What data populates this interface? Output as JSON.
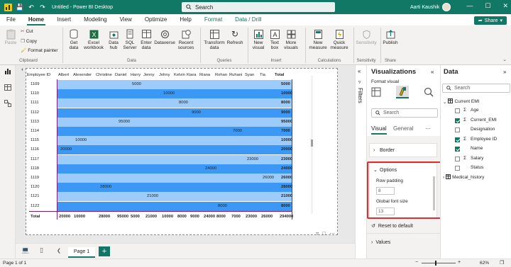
{
  "titlebar": {
    "doc_title": "Untitled - Power BI Desktop",
    "search_placeholder": "Search",
    "user_name": "Aarti Kaushik",
    "minimize": "—",
    "maximize": "☐",
    "close": "✕"
  },
  "menu": {
    "items": [
      "File",
      "Home",
      "Insert",
      "Modeling",
      "View",
      "Optimize",
      "Help",
      "Format",
      "Data / Drill"
    ],
    "share_label": "Share"
  },
  "ribbon": {
    "clipboard": {
      "paste": "Paste",
      "cut": "Cut",
      "copy": "Copy",
      "format_painter": "Format painter",
      "label": "Clipboard"
    },
    "data": {
      "get_data": "Get data",
      "excel_workbook": "Excel workbook",
      "data_hub": "Data hub",
      "sql_server": "SQL Server",
      "enter_data": "Enter data",
      "dataverse": "Dataverse",
      "recent_sources": "Recent sources",
      "label": "Data"
    },
    "queries": {
      "transform_data": "Transform data",
      "refresh": "Refresh",
      "label": "Queries"
    },
    "insert": {
      "new_visual": "New visual",
      "text_box": "Text box",
      "more_visuals": "More visuals",
      "label": "Insert"
    },
    "calculations": {
      "new_measure": "New measure",
      "quick_measure": "Quick measure",
      "label": "Calculations"
    },
    "sensitivity": {
      "sensitivity": "Sensitivity",
      "label": "Sensitivity"
    },
    "share": {
      "publish": "Publish",
      "label": "Share"
    }
  },
  "matrix": {
    "headers": [
      "Employee ID",
      "Albert",
      "Alexender",
      "Christine",
      "Daniel",
      "Harry",
      "Jenny",
      "Johny",
      "Kelvin",
      "Kiara",
      "Riana",
      "Rohan",
      "Ruhani",
      "Syan",
      "Tia",
      "Total"
    ],
    "rows": [
      {
        "id": "1109",
        "col": 5,
        "value": "5000",
        "total": "5000"
      },
      {
        "id": "1110",
        "col": 7,
        "value": "10000",
        "total": "10000"
      },
      {
        "id": "1111",
        "col": 8,
        "value": "8000",
        "total": "8000"
      },
      {
        "id": "1112",
        "col": 9,
        "value": "9000",
        "total": "9000"
      },
      {
        "id": "1113",
        "col": 4,
        "value": "95000",
        "total": "95000"
      },
      {
        "id": "1114",
        "col": 12,
        "value": "7000",
        "total": "7000"
      },
      {
        "id": "1115",
        "col": 2,
        "value": "10000",
        "total": "10000"
      },
      {
        "id": "1116",
        "col": 1,
        "value": "20000",
        "total": "20000"
      },
      {
        "id": "1117",
        "col": 13,
        "value": "23000",
        "total": "23000"
      },
      {
        "id": "1118",
        "col": 10,
        "value": "24000",
        "total": "24000"
      },
      {
        "id": "1119",
        "col": 14,
        "value": "26000",
        "total": "26000"
      },
      {
        "id": "1120",
        "col": 3,
        "value": "28000",
        "total": "28000"
      },
      {
        "id": "1121",
        "col": 6,
        "value": "21000",
        "total": "21000"
      },
      {
        "id": "1122",
        "col": 11,
        "value": "8000",
        "total": "8000"
      }
    ],
    "total_row": {
      "label": "Total",
      "values": [
        "20000",
        "10000",
        "28000",
        "95000",
        "5000",
        "21000",
        "10000",
        "8000",
        "9000",
        "24000",
        "8000",
        "7000",
        "23000",
        "26000",
        "294000"
      ]
    }
  },
  "pages": {
    "tab_label": "Page 1",
    "add_label": "+"
  },
  "status": {
    "page_info": "Page 1 of 1",
    "zoom": "62%"
  },
  "filters": {
    "label": "Filters"
  },
  "visualizations": {
    "title": "Visualizations",
    "format_visual": "Format visual",
    "search_placeholder": "Search",
    "tabs": [
      "Visual",
      "General"
    ],
    "more": "···",
    "border": "Border",
    "options": "Options",
    "row_padding_label": "Row padding",
    "row_padding_value": "8",
    "global_font_label": "Global font size",
    "global_font_value": "13",
    "reset": "Reset to default",
    "values": "Values"
  },
  "data_pane": {
    "title": "Data",
    "search_placeholder": "Search",
    "table1": "Current EMI",
    "fields": [
      {
        "name": "Age",
        "checked": false,
        "sigma": true
      },
      {
        "name": "Current_EMI",
        "checked": true,
        "sigma": true
      },
      {
        "name": "Designation",
        "checked": false,
        "sigma": false
      },
      {
        "name": "Employee ID",
        "checked": true,
        "sigma": true
      },
      {
        "name": "Name",
        "checked": true,
        "sigma": false
      },
      {
        "name": "Salary",
        "checked": false,
        "sigma": true
      },
      {
        "name": "Status",
        "checked": false,
        "sigma": false
      }
    ],
    "table2": "Medical_history"
  },
  "colors": {
    "brand": "#117865",
    "row_dark": "#3b98f5",
    "row_light": "#9dcbfa",
    "highlight": "#d63030"
  }
}
